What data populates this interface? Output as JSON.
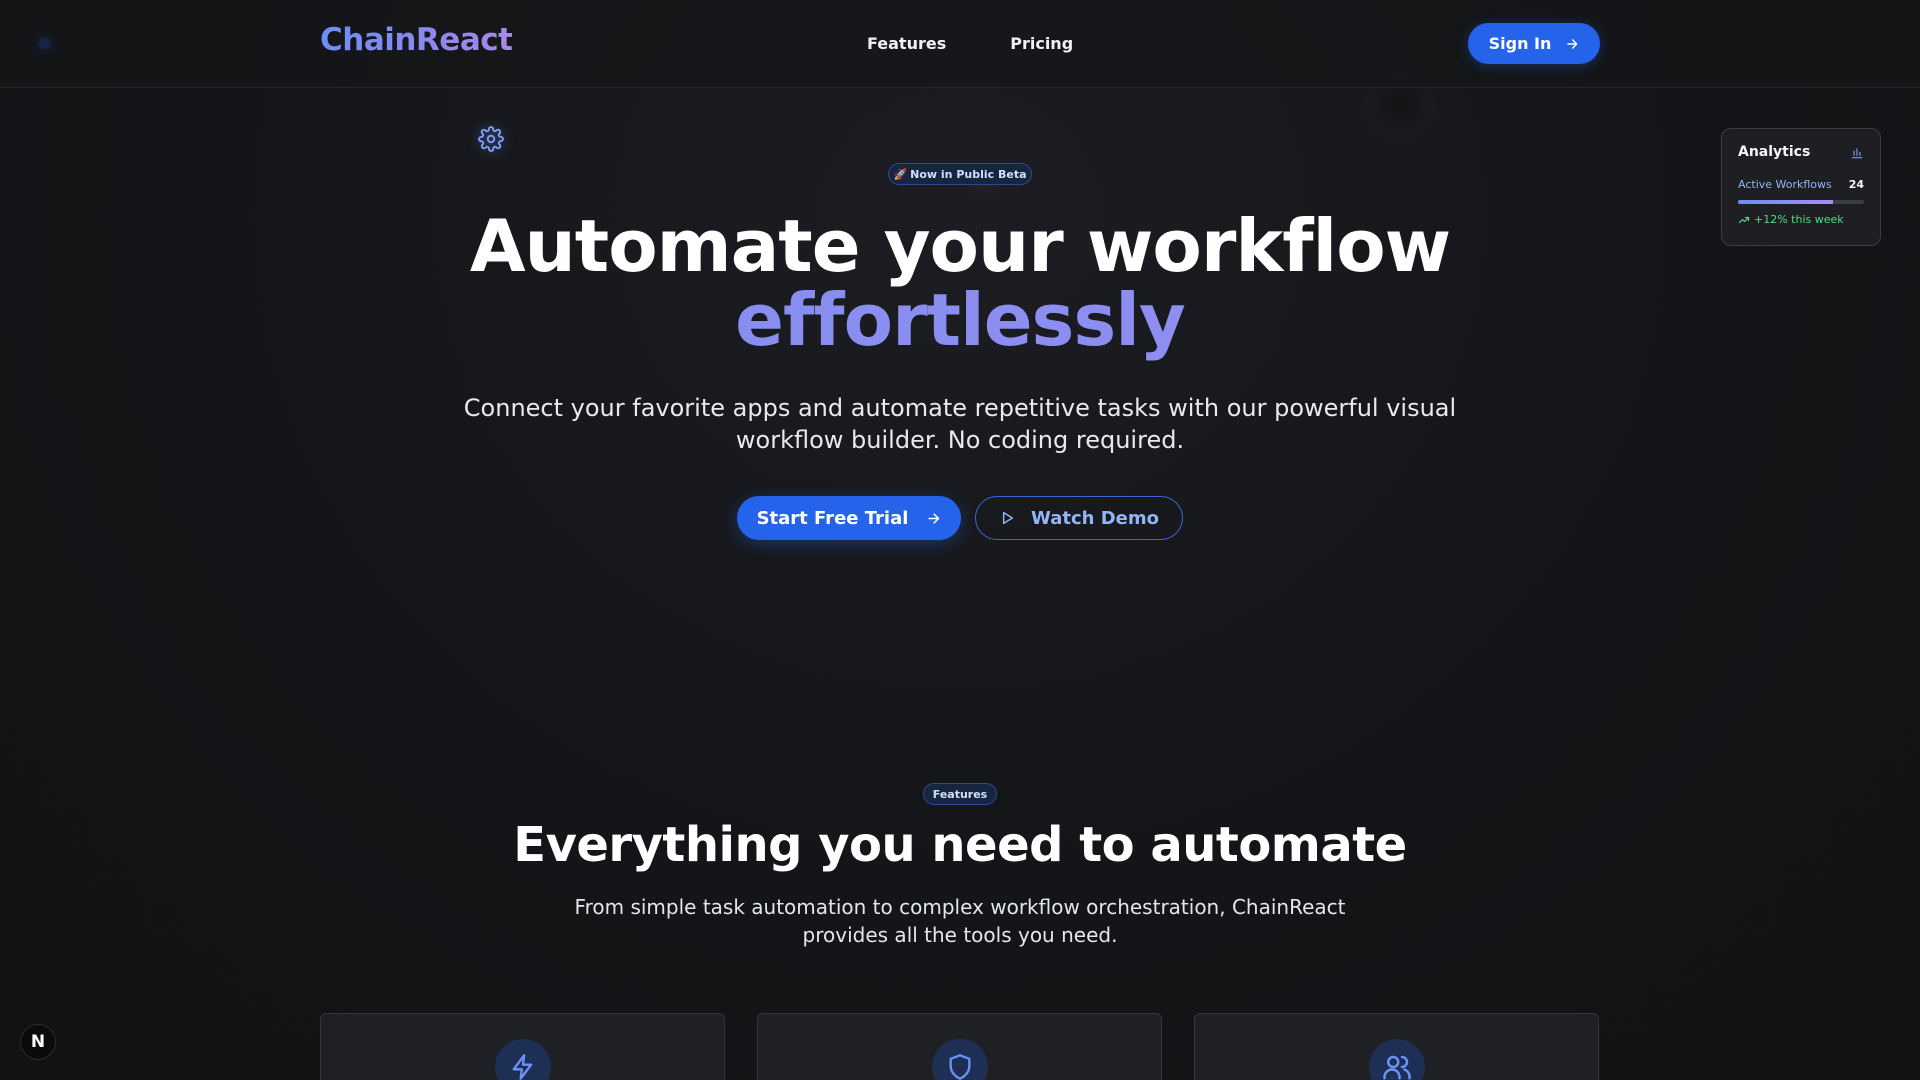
{
  "header": {
    "logo": "ChainReact",
    "nav": [
      "Features",
      "Pricing"
    ],
    "sign_in": "Sign In"
  },
  "analytics": {
    "title": "Analytics",
    "metric_label": "Active Workflows",
    "metric_value": "24",
    "progress_fraction": 0.75,
    "trend": "+12% this week"
  },
  "hero": {
    "badge": "Now in Public Beta",
    "badge_icon": "rocket-icon",
    "title_line1": "Automate your workflow",
    "title_line2": "effortlessly",
    "subtitle": "Connect your favorite apps and automate repetitive tasks with our powerful visual workflow builder. No coding required.",
    "primary_cta": "Start Free Trial",
    "secondary_cta": "Watch Demo"
  },
  "features": {
    "badge": "Features",
    "title": "Everything you need to automate",
    "subtitle": "From simple task automation to complex workflow orchestration, ChainReact provides all the tools you need.",
    "cards": [
      {
        "icon": "lightning-icon"
      },
      {
        "icon": "shield-icon"
      },
      {
        "icon": "users-icon"
      }
    ]
  },
  "dev_badge": "N",
  "colors": {
    "accent": "#2563eb",
    "gradient_start": "#6b8ff5",
    "gradient_end": "#a78bfa",
    "trend_green": "#4ade80"
  }
}
